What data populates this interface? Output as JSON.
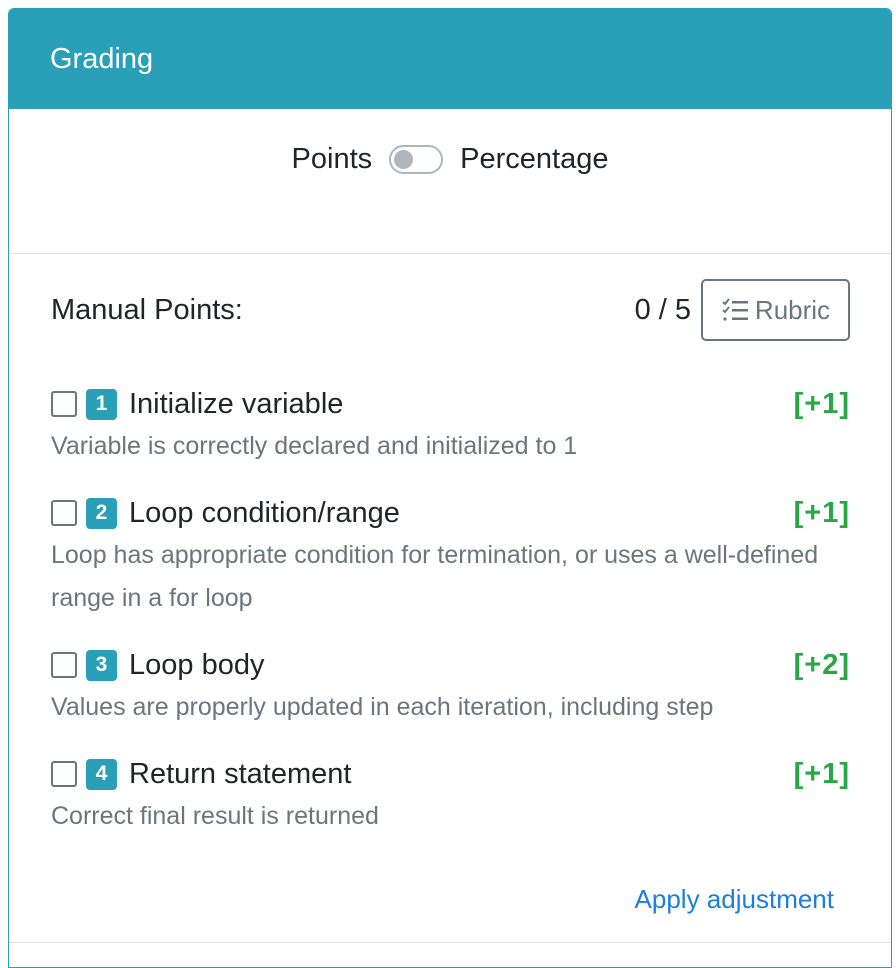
{
  "header": {
    "title": "Grading"
  },
  "toggle": {
    "left_label": "Points",
    "right_label": "Percentage"
  },
  "manual": {
    "label": "Manual Points:",
    "score": "0 / 5",
    "rubric_button": "Rubric"
  },
  "items": [
    {
      "number": "1",
      "title": "Initialize variable",
      "points": "[+1]",
      "description": "Variable is correctly declared and initialized to 1"
    },
    {
      "number": "2",
      "title": "Loop condition/range",
      "points": "[+1]",
      "description": "Loop has appropriate condition for termination, or uses a well-defined range in a for loop"
    },
    {
      "number": "3",
      "title": "Loop body",
      "points": "[+2]",
      "description": "Values are properly updated in each iteration, including step"
    },
    {
      "number": "4",
      "title": "Return statement",
      "points": "[+1]",
      "description": "Correct final result is returned"
    }
  ],
  "apply_link": "Apply adjustment"
}
